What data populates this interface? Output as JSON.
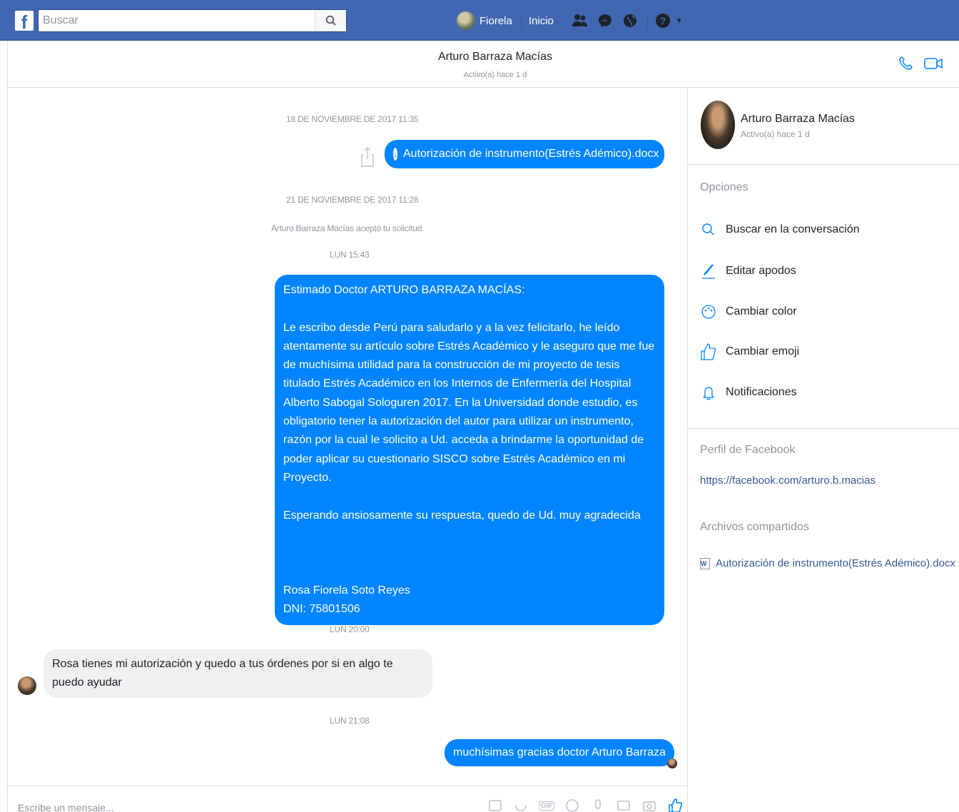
{
  "topbar": {
    "search_placeholder": "Buscar",
    "user_name": "Fiorela",
    "home_label": "Inicio"
  },
  "conversation": {
    "name": "Arturo Barraza Macías",
    "status": "Activo(a) hace 1 d"
  },
  "messages": {
    "ts1": "18 DE NOVIEMBRE DE 2017 11:35",
    "file_name": "Autorización de instrumento(Estrés Adémico).docx",
    "ts2": "21 DE NOVIEMBRE DE 2017 11:28",
    "system_note": "Arturo Barraza Macías aceptó tu solicitud.",
    "ts3": "LUN 15:43",
    "long_message": "Estimado Doctor ARTURO BARRAZA MACÍAS:\n\nLe escribo desde Perú para saludarlo y  a la vez felicitarlo, he leído atentamente su artículo sobre Estrés Académico y  le aseguro que me fue de muchísima utilidad para la construcción de mi proyecto de tesis titulado Estrés Académico en los Internos de Enfermería del Hospital Alberto Sabogal Sologuren 2017. En la Universidad donde estudio, es obligatorio tener la autorización del autor  para utilizar  un instrumento, razón por la cual  le solicito a Ud. acceda a brindarme  la oportunidad  de poder aplicar  su cuestionario SISCO  sobre  Estrés Académico en mi Proyecto.\n\nEsperando ansiosamente su respuesta, quedo de Ud. muy agradecida\n\n\n\nRosa Fiorela Soto Reyes\nDNI: 75801506",
    "ts4": "LUN 20:00",
    "reply_in": "Rosa tienes mi autorización y quedo a tus órdenes por si en algo te puedo ayudar",
    "ts5": "LUN 21:08",
    "reply_out": "muchísimas gracias doctor Arturo Barraza"
  },
  "composer": {
    "placeholder": "Escribe un mensaje...",
    "gif_label": "GIF"
  },
  "right_panel": {
    "name": "Arturo Barraza Macías",
    "status": "Activo(a) hace 1 d",
    "options_title": "Opciones",
    "options": [
      {
        "label": "Buscar en la conversación",
        "icon": "search-icon"
      },
      {
        "label": "Editar apodos",
        "icon": "pencil-icon"
      },
      {
        "label": "Cambiar color",
        "icon": "palette-icon"
      },
      {
        "label": "Cambiar emoji",
        "icon": "thumbs-up-icon"
      },
      {
        "label": "Notificaciones",
        "icon": "bell-icon"
      }
    ],
    "profile_title": "Perfil de Facebook",
    "profile_link": "https://facebook.com/arturo.b.macias",
    "shared_title": "Archivos compartidos",
    "shared_file": "Autorización de instrumento(Estrés Adémico).docx"
  },
  "colors": {
    "topbar": "#4267b2",
    "bubble_out": "#0084ff",
    "bubble_in": "#f1f0f0",
    "link": "#365899",
    "muted": "#90949c"
  }
}
